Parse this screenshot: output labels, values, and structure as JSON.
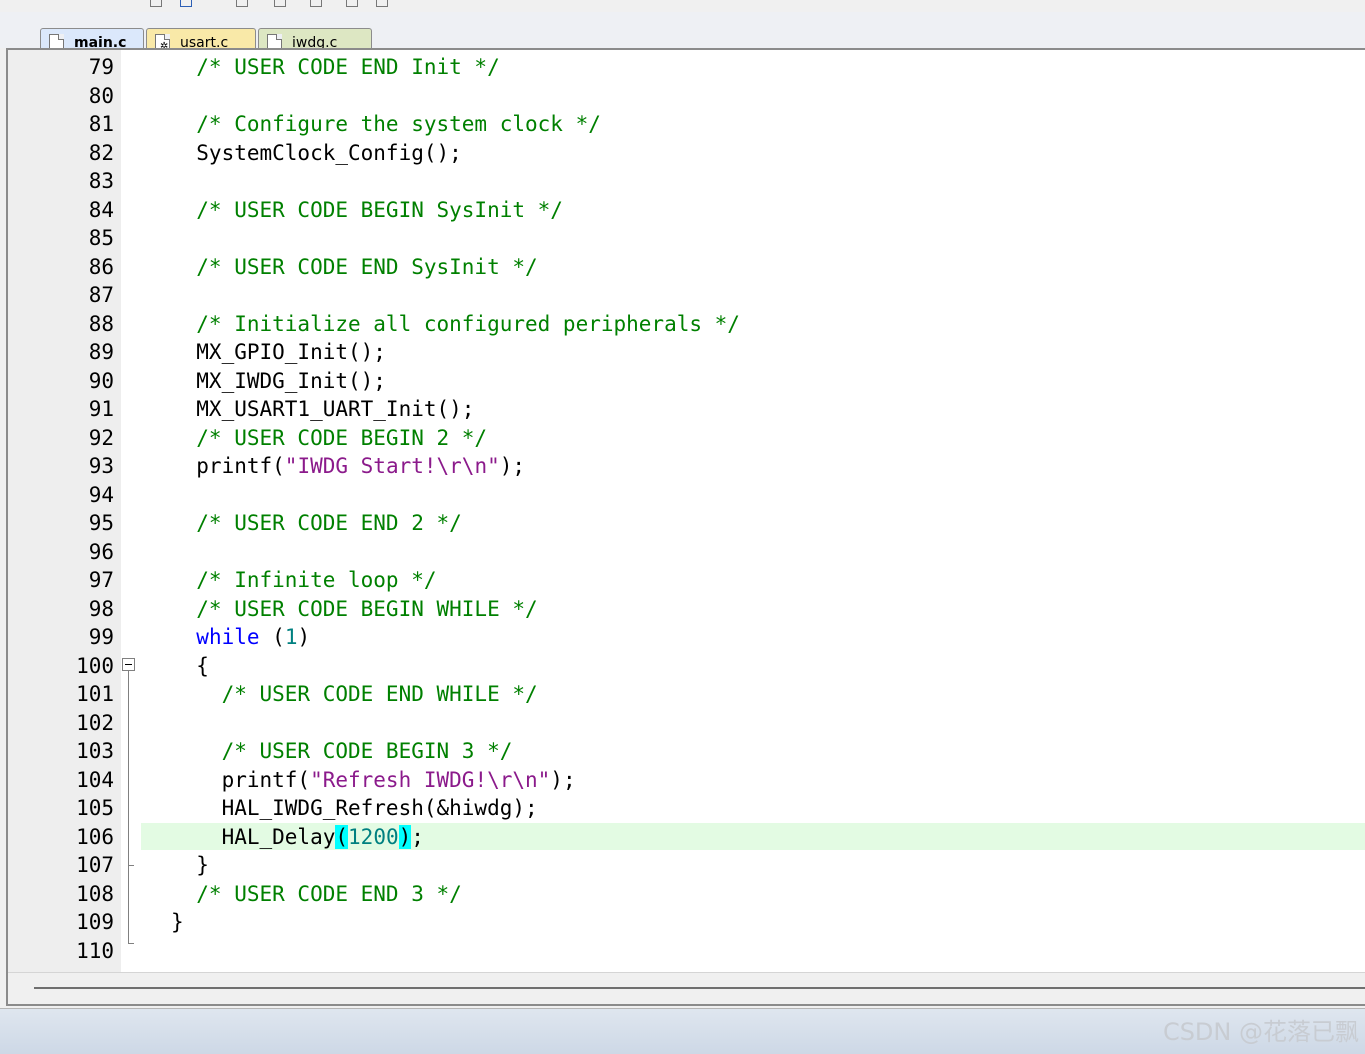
{
  "tabs": [
    {
      "label": "main.c",
      "icon": "file-icon",
      "active": true
    },
    {
      "label": "usart.c",
      "icon": "gear-file-icon",
      "active": false
    },
    {
      "label": "iwdg.c",
      "icon": "file-icon",
      "active": false
    }
  ],
  "lines": [
    {
      "n": "79",
      "tokens": [
        {
          "t": "  /* USER CODE END Init */",
          "c": "cm"
        }
      ]
    },
    {
      "n": "80",
      "tokens": []
    },
    {
      "n": "81",
      "tokens": [
        {
          "t": "  /* Configure the system clock */",
          "c": "cm"
        }
      ]
    },
    {
      "n": "82",
      "tokens": [
        {
          "t": "  SystemClock_Config();",
          "c": ""
        }
      ]
    },
    {
      "n": "83",
      "tokens": []
    },
    {
      "n": "84",
      "tokens": [
        {
          "t": "  /* USER CODE BEGIN SysInit */",
          "c": "cm"
        }
      ]
    },
    {
      "n": "85",
      "tokens": []
    },
    {
      "n": "86",
      "tokens": [
        {
          "t": "  /* USER CODE END SysInit */",
          "c": "cm"
        }
      ]
    },
    {
      "n": "87",
      "tokens": []
    },
    {
      "n": "88",
      "tokens": [
        {
          "t": "  /* Initialize all configured peripherals */",
          "c": "cm"
        }
      ]
    },
    {
      "n": "89",
      "tokens": [
        {
          "t": "  MX_GPIO_Init();",
          "c": ""
        }
      ]
    },
    {
      "n": "90",
      "tokens": [
        {
          "t": "  MX_IWDG_Init();",
          "c": ""
        }
      ]
    },
    {
      "n": "91",
      "tokens": [
        {
          "t": "  MX_USART1_UART_Init();",
          "c": ""
        }
      ]
    },
    {
      "n": "92",
      "tokens": [
        {
          "t": "  /* USER CODE BEGIN 2 */",
          "c": "cm"
        }
      ]
    },
    {
      "n": "93",
      "tokens": [
        {
          "t": "  printf(",
          "c": ""
        },
        {
          "t": "\"IWDG Start!\\r\\n\"",
          "c": "str2"
        },
        {
          "t": ");",
          "c": ""
        }
      ]
    },
    {
      "n": "94",
      "tokens": []
    },
    {
      "n": "95",
      "tokens": [
        {
          "t": "  /* USER CODE END 2 */",
          "c": "cm"
        }
      ]
    },
    {
      "n": "96",
      "tokens": []
    },
    {
      "n": "97",
      "tokens": [
        {
          "t": "  /* Infinite loop */",
          "c": "cm"
        }
      ]
    },
    {
      "n": "98",
      "tokens": [
        {
          "t": "  /* USER CODE BEGIN WHILE */",
          "c": "cm"
        }
      ]
    },
    {
      "n": "99",
      "tokens": [
        {
          "t": "  ",
          "c": ""
        },
        {
          "t": "while",
          "c": "kw"
        },
        {
          "t": " (",
          "c": ""
        },
        {
          "t": "1",
          "c": "num"
        },
        {
          "t": ")",
          "c": ""
        }
      ]
    },
    {
      "n": "100",
      "tokens": [
        {
          "t": "  {",
          "c": ""
        }
      ]
    },
    {
      "n": "101",
      "tokens": [
        {
          "t": "    /* USER CODE END WHILE */",
          "c": "cm"
        }
      ]
    },
    {
      "n": "102",
      "tokens": []
    },
    {
      "n": "103",
      "tokens": [
        {
          "t": "    /* USER CODE BEGIN 3 */",
          "c": "cm"
        }
      ]
    },
    {
      "n": "104",
      "tokens": [
        {
          "t": "    printf(",
          "c": ""
        },
        {
          "t": "\"Refresh IWDG!\\r\\n\"",
          "c": "str2"
        },
        {
          "t": ");",
          "c": ""
        }
      ]
    },
    {
      "n": "105",
      "tokens": [
        {
          "t": "    HAL_IWDG_Refresh(&hiwdg);",
          "c": ""
        }
      ]
    },
    {
      "n": "106",
      "tokens": [
        {
          "t": "    HAL_Delay",
          "c": ""
        },
        {
          "t": "(",
          "c": "brace-hl"
        },
        {
          "t": "1200",
          "c": "num"
        },
        {
          "t": ")",
          "c": "brace-hl"
        },
        {
          "t": ";",
          "c": ""
        }
      ]
    },
    {
      "n": "107",
      "tokens": [
        {
          "t": "  }",
          "c": ""
        }
      ]
    },
    {
      "n": "108",
      "tokens": [
        {
          "t": "  /* USER CODE END 3 */",
          "c": "cm"
        }
      ]
    },
    {
      "n": "109",
      "tokens": [
        {
          "t": "}",
          "c": ""
        }
      ]
    },
    {
      "n": "110",
      "tokens": []
    }
  ],
  "current_line": "106",
  "watermark": "CSDN @花落已飘"
}
